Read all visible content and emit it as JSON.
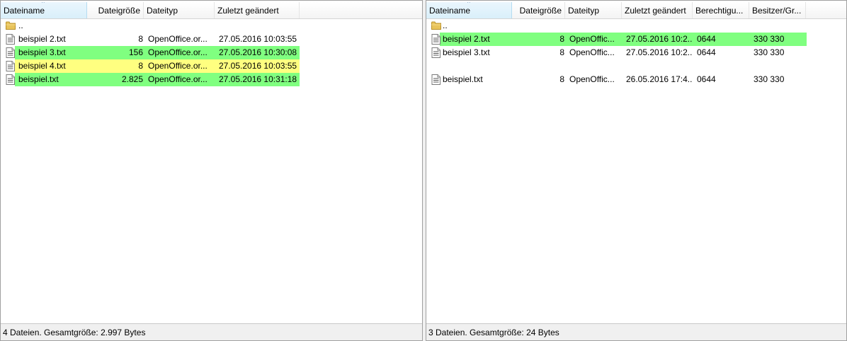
{
  "colors": {
    "green": "#80ff80",
    "yellow": "#ffff80"
  },
  "left": {
    "headers": {
      "name": "Dateiname",
      "size": "Dateigröße",
      "type": "Dateityp",
      "modified": "Zuletzt geändert"
    },
    "parent": "..",
    "files": [
      {
        "name": "beispiel 2.txt",
        "size": "8",
        "type": "OpenOffice.or...",
        "modified": "27.05.2016 10:03:55",
        "highlight": "none"
      },
      {
        "name": "beispiel 3.txt",
        "size": "156",
        "type": "OpenOffice.or...",
        "modified": "27.05.2016 10:30:08",
        "highlight": "green"
      },
      {
        "name": "beispiel 4.txt",
        "size": "8",
        "type": "OpenOffice.or...",
        "modified": "27.05.2016 10:03:55",
        "highlight": "yellow"
      },
      {
        "name": "beispiel.txt",
        "size": "2.825",
        "type": "OpenOffice.or...",
        "modified": "27.05.2016 10:31:18",
        "highlight": "green"
      }
    ],
    "status": "4 Dateien. Gesamtgröße: 2.997 Bytes"
  },
  "right": {
    "headers": {
      "name": "Dateiname",
      "size": "Dateigröße",
      "type": "Dateityp",
      "modified": "Zuletzt geändert",
      "permissions": "Berechtigu...",
      "owner": "Besitzer/Gr..."
    },
    "parent": "..",
    "files": [
      {
        "name": "beispiel 2.txt",
        "size": "8",
        "type": "OpenOffic...",
        "modified": "27.05.2016 10:2...",
        "permissions": "0644",
        "owner": "330 330",
        "highlight": "green"
      },
      {
        "name": "beispiel 3.txt",
        "size": "8",
        "type": "OpenOffic...",
        "modified": "27.05.2016 10:2...",
        "permissions": "0644",
        "owner": "330 330",
        "highlight": "none"
      },
      {
        "name": "beispiel.txt",
        "size": "8",
        "type": "OpenOffic...",
        "modified": "26.05.2016 17:4...",
        "permissions": "0644",
        "owner": "330 330",
        "highlight": "none"
      }
    ],
    "status": "3 Dateien. Gesamtgröße: 24 Bytes"
  }
}
